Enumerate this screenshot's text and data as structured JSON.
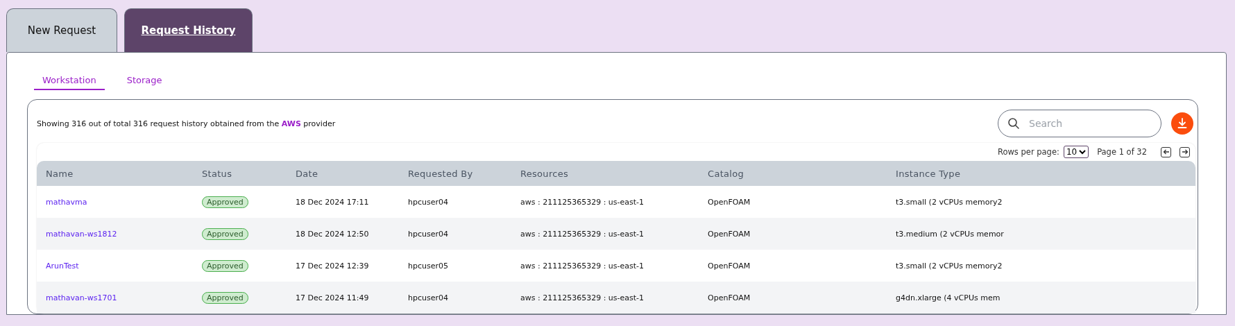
{
  "tabs": [
    {
      "label": "New Request",
      "selected": false
    },
    {
      "label": "Request History",
      "selected": true
    }
  ],
  "subtabs": [
    {
      "label": "Workstation",
      "selected": true
    },
    {
      "label": "Storage",
      "selected": false
    }
  ],
  "summary": {
    "before": "Showing 316 out of total 316 request history obtained from the",
    "provider": "AWS",
    "after": "provider"
  },
  "search": {
    "placeholder": "Search"
  },
  "pagination": {
    "rows_label": "Rows per page:",
    "rows_value": "10",
    "page_label": "Page 1 of 32"
  },
  "table": {
    "columns": [
      "Name",
      "Status",
      "Date",
      "Requested By",
      "Resources",
      "Catalog",
      "Instance Type"
    ],
    "rows": [
      {
        "name": "mathavma",
        "status": "Approved",
        "date": "18 Dec 2024 17:11",
        "requested_by": "hpcuser04",
        "resources": "aws : 211125365329 : us-east-1",
        "catalog": "OpenFOAM",
        "instance_type": "t3.small (2 vCPUs memory2"
      },
      {
        "name": "mathavan-ws1812",
        "status": "Approved",
        "date": "18 Dec 2024 12:50",
        "requested_by": "hpcuser04",
        "resources": "aws : 211125365329 : us-east-1",
        "catalog": "OpenFOAM",
        "instance_type": "t3.medium (2 vCPUs memor"
      },
      {
        "name": "ArunTest",
        "status": "Approved",
        "date": "17 Dec 2024 12:39",
        "requested_by": "hpcuser05",
        "resources": "aws : 211125365329 : us-east-1",
        "catalog": "OpenFOAM",
        "instance_type": "t3.small (2 vCPUs memory2"
      },
      {
        "name": "mathavan-ws1701",
        "status": "Approved",
        "date": "17 Dec 2024 11:49",
        "requested_by": "hpcuser04",
        "resources": "aws : 211125365329 : us-east-1",
        "catalog": "OpenFOAM",
        "instance_type": "g4dn.xlarge (4 vCPUs mem"
      }
    ]
  }
}
